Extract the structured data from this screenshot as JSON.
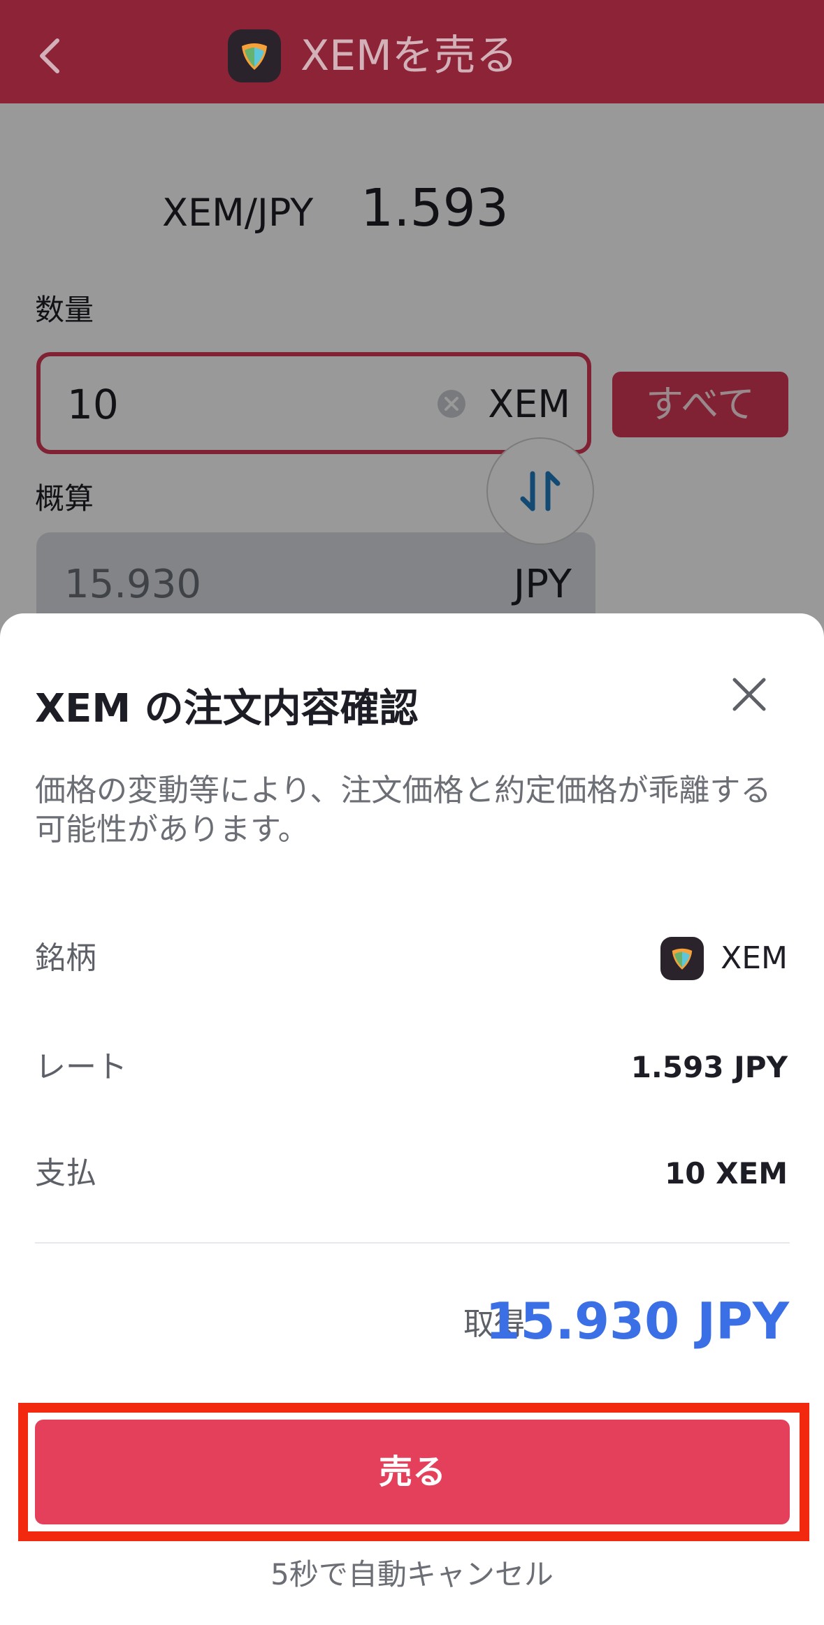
{
  "header": {
    "title": "XEMを売る",
    "coin_icon": "nem-logo-icon",
    "back_icon": "chevron-left-icon"
  },
  "form": {
    "pair": "XEM/JPY",
    "price": "1.593",
    "quantity_label": "数量",
    "quantity_value": "10",
    "quantity_unit": "XEM",
    "all_button": "すべて",
    "estimate_label": "概算",
    "estimate_value": "15.930",
    "estimate_unit": "JPY"
  },
  "sheet": {
    "title": "XEM の注文内容確認",
    "note": "価格の変動等により、注文価格と約定価格が乖離する可能性があります。",
    "rows": [
      {
        "label": "銘柄",
        "value": "XEM"
      },
      {
        "label": "レート",
        "value": "1.593 JPY"
      },
      {
        "label": "支払",
        "value": "10 XEM"
      }
    ],
    "receive_label": "取得",
    "receive_value": "15.930 JPY",
    "sell_button": "売る",
    "auto_cancel": "5秒で自動キャンセル"
  },
  "colors": {
    "header_bg": "#8c2336",
    "accent": "#e43f5b",
    "receive_blue": "#3a6fe6",
    "highlight_frame": "#f2280f"
  }
}
